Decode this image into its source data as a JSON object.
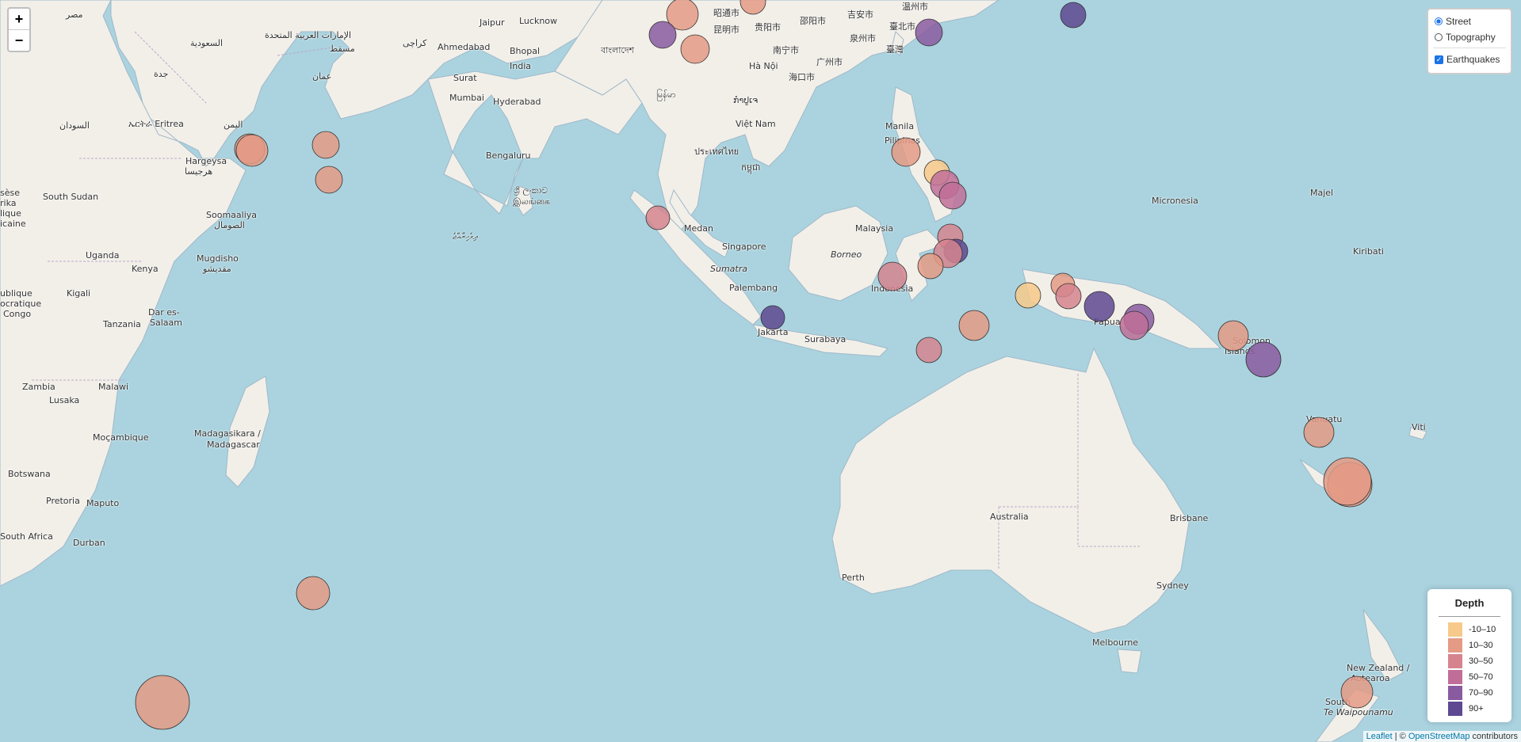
{
  "zoom": {
    "in_label": "+",
    "out_label": "−"
  },
  "layers": {
    "street": "Street",
    "topography": "Topography",
    "earthquakes": "Earthquakes"
  },
  "legend": {
    "title": "Depth",
    "items": [
      {
        "label": "-10–10",
        "color": "#f7c98a"
      },
      {
        "label": "10–30",
        "color": "#e49a85"
      },
      {
        "label": "30–50",
        "color": "#d5848e"
      },
      {
        "label": "50–70",
        "color": "#c06e98"
      },
      {
        "label": "70–90",
        "color": "#8a5aa0"
      },
      {
        "label": "90+",
        "color": "#5e4891"
      }
    ]
  },
  "attribution": {
    "leaflet": "Leaflet",
    "sep": " | © ",
    "osm": "OpenStreetMap",
    "tail": " contributors"
  },
  "labels": {
    "misr": "مصر",
    "suwd": "السعودية",
    "emirates": "الإمارات العربية المتحدة",
    "muscat": "مسقط",
    "oman": "عمان",
    "jeddah": "جدة",
    "sudan": "السودان",
    "eritrea": "ኤርትራ Eritrea",
    "yemen": "اليمن",
    "hargeysa": "Hargeysa",
    "hargeysa2": "هرجيسا",
    "south_sudan": "South Sudan",
    "soomaaliya": "Soomaaliya",
    "somal": "الصومال",
    "mugdisho": "Mugdisho",
    "mugdisho2": "مقديشو",
    "uganda": "Uganda",
    "kenya": "Kenya",
    "kigali": "Kigali",
    "dar": "Dar es-",
    "salaam": "Salaam",
    "tanzania": "Tanzania",
    "zambia": "Zambia",
    "malawi": "Malawi",
    "lusaka": "Lusaka",
    "mocambique": "Moçambique",
    "botswana": "Botswana",
    "pretoria": "Pretoria",
    "maputo": "Maputo",
    "south_africa": "South Africa",
    "durban": "Durban",
    "madagasikara": "Madagasikara /",
    "madagascar": "Madagascar",
    "karachi": "کراچی",
    "jaipur": "Jaipur",
    "lucknow": "Lucknow",
    "ahmedabad": "Ahmedabad",
    "bhopal": "Bhopal",
    "india": "India",
    "surat": "Surat",
    "mumbai": "Mumbai",
    "hyderabad": "Hyderabad",
    "bengaluru": "Bengaluru",
    "srilanka": "ශ්‍රී ලංකාව",
    "srilanka2": "இலங்கை",
    "maldives": "ދިވެހިރާއްޖެ",
    "bangladesh": "বাংলাদেশ",
    "myanmar": "မြန်မာ",
    "kunming": "昆明市",
    "zhaotong": "昭通市",
    "guiyang": "贵阳市",
    "shaoyang": "邵阳市",
    "jian": "吉安市",
    "wenzhou": "温州市",
    "taipei": "臺北市",
    "quanzhou": "泉州市",
    "taiwan": "臺灣",
    "nanning": "南宁市",
    "guangzhou": "广州市",
    "hanoi": "Hà Nội",
    "haikou": "海口市",
    "thailand": "ประเทศไทย",
    "vietnam": "Việt Nam",
    "cambodia": "កម្ពុជា",
    "cambodia2": "ກຳປູເຈ",
    "manila": "Manila",
    "philippines": "Pilipinas",
    "medan": "Medan",
    "malaysia": "Malaysia",
    "borneo": "Borneo",
    "singapore": "Singapore",
    "sumatra": "Sumatra",
    "palembang": "Palembang",
    "indonesia": "Indonesia",
    "jakarta": "Jakarta",
    "surabaya": "Surabaya",
    "papua": "Papua",
    "micronesia": "Micronesia",
    "majel": "Majel",
    "kiribati": "Kiribati",
    "solomon": "Solomon",
    "islands": "Islands",
    "vanuatu": "Vanuatu",
    "viti": "Viti",
    "australia": "Australia",
    "brisbane": "Brisbane",
    "perth": "Perth",
    "sydney": "Sydney",
    "melbourne": "Melbourne",
    "newzealand": "New Zealand /",
    "aotearoa": "Aotearoa",
    "south": "South",
    "tewai": "Te Waipounamu",
    "drc": "ublique",
    "drc2": "ocratique",
    "congo": "Congo",
    "sese": "sèse",
    "rika": "rika",
    "lique": "lique",
    "icaine": "icaine"
  },
  "map_layer": {
    "base": "Street",
    "overlay": "Earthquakes"
  }
}
